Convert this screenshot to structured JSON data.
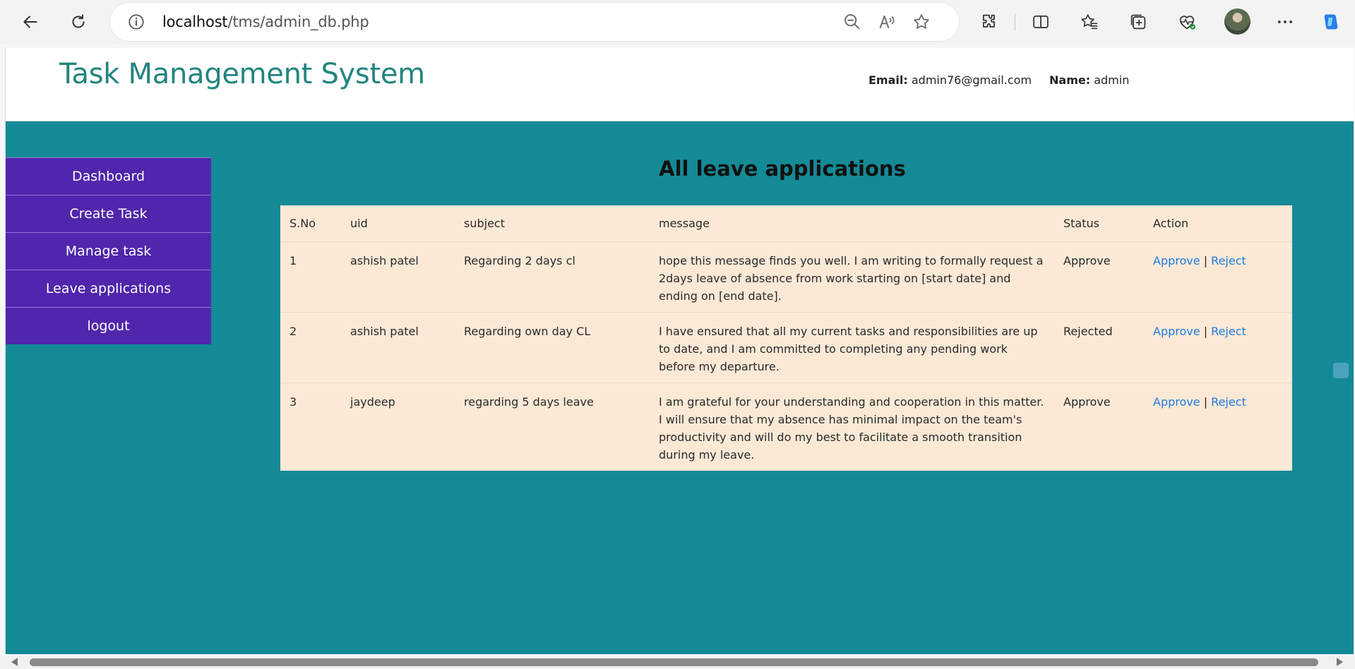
{
  "browser": {
    "url_host": "localhost",
    "url_path": "/tms/admin_db.php"
  },
  "header": {
    "title": "Task Management System",
    "email_label": "Email:",
    "email_value": "admin76@gmail.com",
    "name_label": "Name:",
    "name_value": "admin"
  },
  "sidebar": {
    "items": [
      {
        "label": "Dashboard"
      },
      {
        "label": "Create Task"
      },
      {
        "label": "Manage task"
      },
      {
        "label": "Leave applications"
      },
      {
        "label": "logout"
      }
    ]
  },
  "main": {
    "title": "All leave applications",
    "columns": [
      "S.No",
      "uid",
      "subject",
      "message",
      "Status",
      "Action"
    ],
    "rows": [
      {
        "sno": "1",
        "uid": "ashish patel",
        "subject": "Regarding 2 days cl",
        "message": "hope this message finds you well. I am writing to formally request a 2days leave of absence from work starting on [start date] and ending on [end date].",
        "status": "Approve",
        "approve": "Approve",
        "separator": "|",
        "reject": "Reject"
      },
      {
        "sno": "2",
        "uid": "ashish patel",
        "subject": "Regarding own day CL",
        "message": "I have ensured that all my current tasks and responsibilities are up to date, and I am committed to completing any pending work before my departure.",
        "status": "Rejected",
        "approve": "Approve",
        "separator": "|",
        "reject": "Reject"
      },
      {
        "sno": "3",
        "uid": "jaydeep",
        "subject": "regarding 5 days leave",
        "message": "I am grateful for your understanding and cooperation in this matter. I will ensure that my absence has minimal impact on the team's productivity and will do my best to facilitate a smooth transition during my leave.",
        "status": "Approve",
        "approve": "Approve",
        "separator": "|",
        "reject": "Reject"
      }
    ]
  },
  "colors": {
    "page_bg": "#148a97",
    "sidebar_bg": "#5026ac",
    "table_bg": "#fbe9d6",
    "title_color": "#22857f",
    "link_color": "#1f7ae0"
  }
}
